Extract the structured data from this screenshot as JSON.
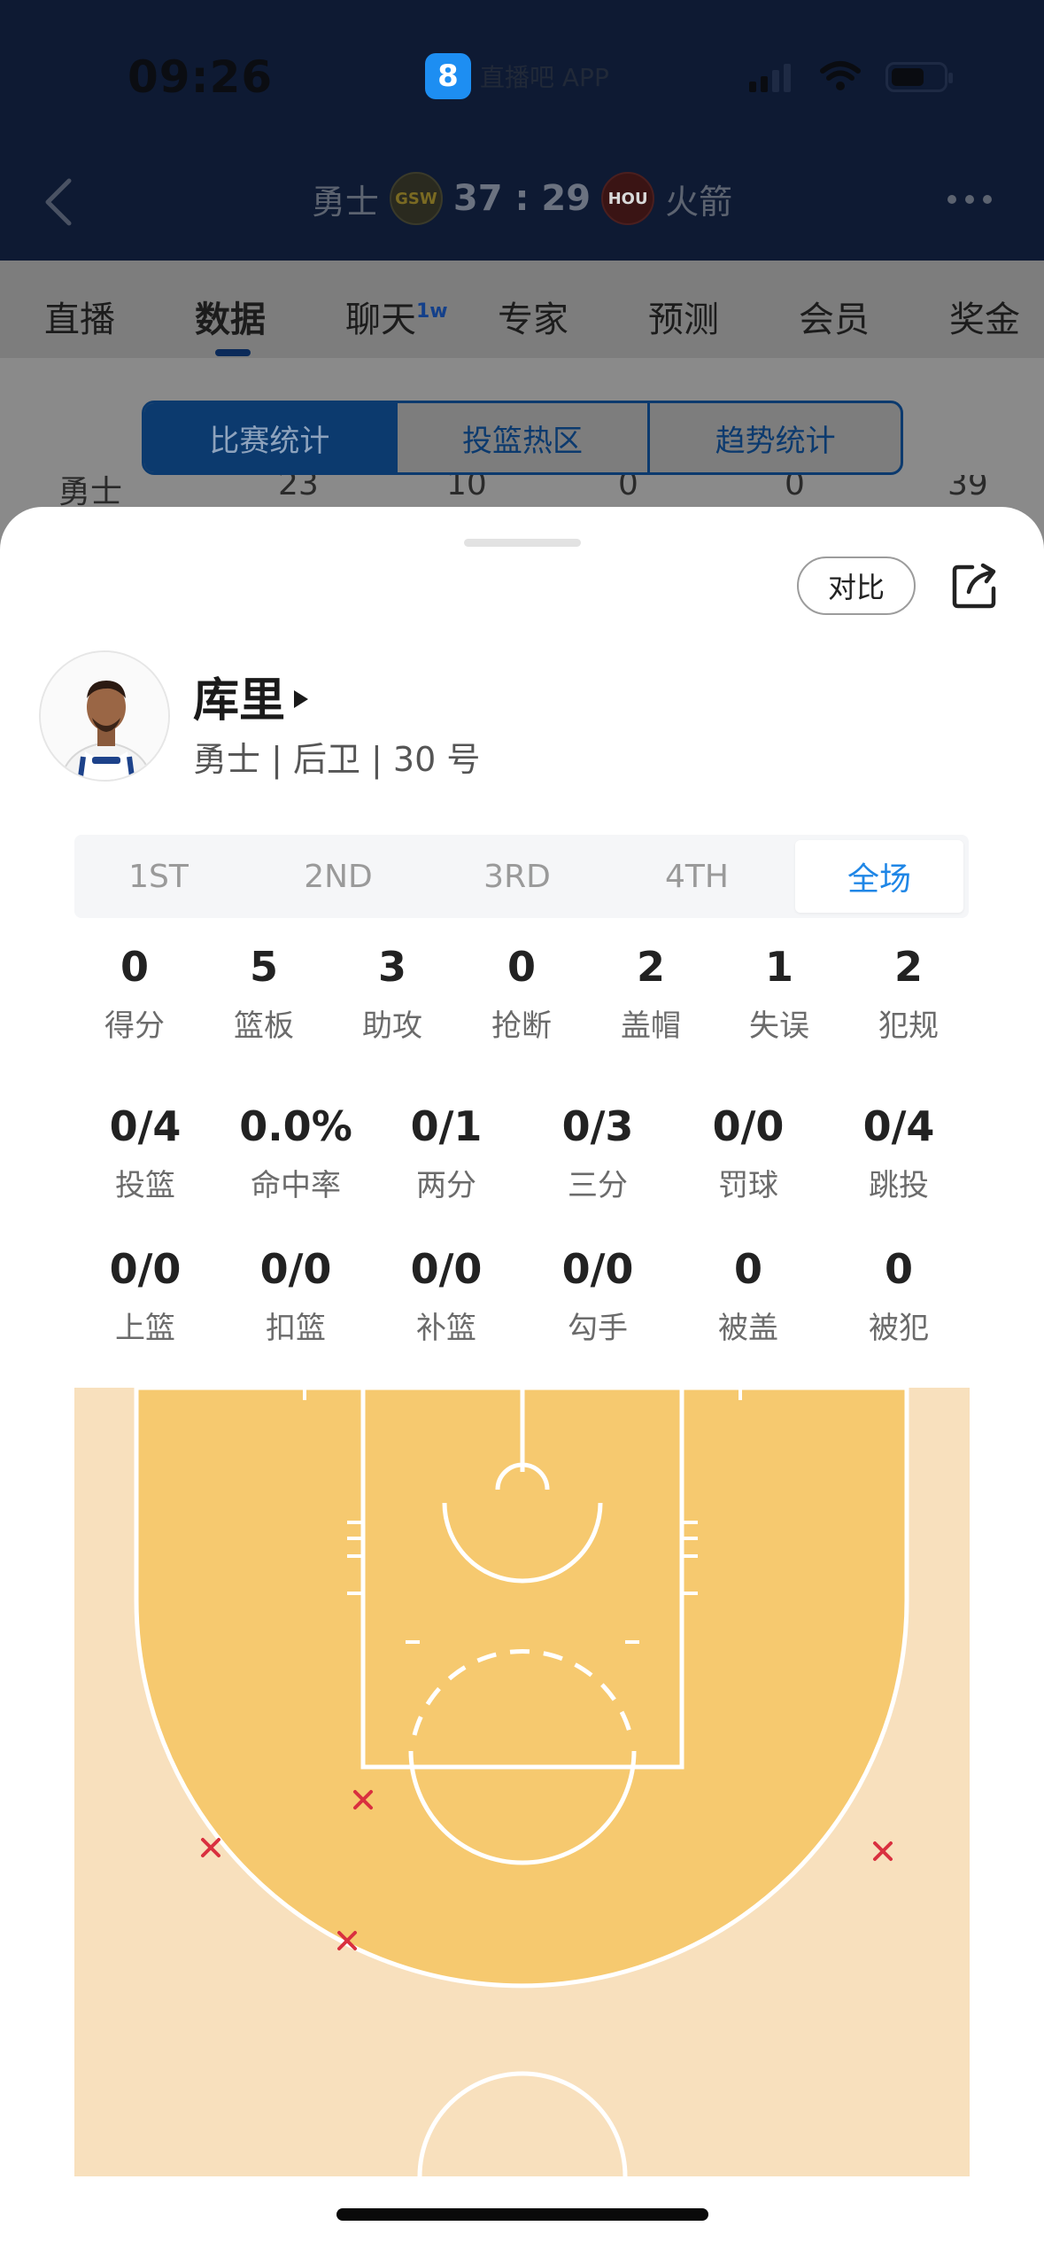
{
  "status_bar": {
    "time": "09:26",
    "app_label": "直播吧 APP",
    "app_logo_glyph": "8"
  },
  "game": {
    "home_team": "勇士",
    "home_logo": "GSW",
    "score": "37 : 29",
    "away_logo": "HOU",
    "away_team": "火箭"
  },
  "tabs": [
    {
      "label": "直播"
    },
    {
      "label": "数据"
    },
    {
      "label": "聊天",
      "badge": "1w"
    },
    {
      "label": "专家"
    },
    {
      "label": "预测"
    },
    {
      "label": "会员"
    },
    {
      "label": "奖金"
    }
  ],
  "active_tab": "数据",
  "subtabs": [
    {
      "label": "比赛统计"
    },
    {
      "label": "投篮热区"
    },
    {
      "label": "趋势统计"
    }
  ],
  "background_row": {
    "team": "勇士",
    "values": [
      "23",
      "10",
      "0",
      "0",
      "39"
    ]
  },
  "sheet": {
    "compare_label": "对比",
    "player": {
      "name": "库里",
      "meta": "勇士 | 后卫 | 30 号"
    },
    "periods": [
      {
        "label": "1ST"
      },
      {
        "label": "2ND"
      },
      {
        "label": "3RD"
      },
      {
        "label": "4TH"
      },
      {
        "label": "全场"
      }
    ],
    "active_period": "全场",
    "stats_row1": [
      {
        "value": "0",
        "label": "得分"
      },
      {
        "value": "5",
        "label": "篮板"
      },
      {
        "value": "3",
        "label": "助攻"
      },
      {
        "value": "0",
        "label": "抢断"
      },
      {
        "value": "2",
        "label": "盖帽"
      },
      {
        "value": "1",
        "label": "失误"
      },
      {
        "value": "2",
        "label": "犯规"
      }
    ],
    "stats_row2": [
      {
        "value": "0/4",
        "label": "投篮"
      },
      {
        "value": "0.0%",
        "label": "命中率"
      },
      {
        "value": "0/1",
        "label": "两分"
      },
      {
        "value": "0/3",
        "label": "三分"
      },
      {
        "value": "0/0",
        "label": "罚球"
      },
      {
        "value": "0/4",
        "label": "跳投"
      }
    ],
    "stats_row3": [
      {
        "value": "0/0",
        "label": "上篮"
      },
      {
        "value": "0/0",
        "label": "扣篮"
      },
      {
        "value": "0/0",
        "label": "补篮"
      },
      {
        "value": "0/0",
        "label": "勾手"
      },
      {
        "value": "0",
        "label": "被盖"
      },
      {
        "value": "0",
        "label": "被犯"
      }
    ],
    "shot_chart": {
      "made_count": 0,
      "missed_count": 4,
      "miss_marker": "×",
      "colors": {
        "inside_arc": "#f6c96f",
        "outside_arc": "#f8e0bd",
        "lines": "#ffffff",
        "miss": "#d9303f"
      }
    }
  },
  "colors": {
    "accent": "#1f86e6",
    "header_bg": "#0e1a33",
    "subtab_border": "#0c3a6e"
  }
}
